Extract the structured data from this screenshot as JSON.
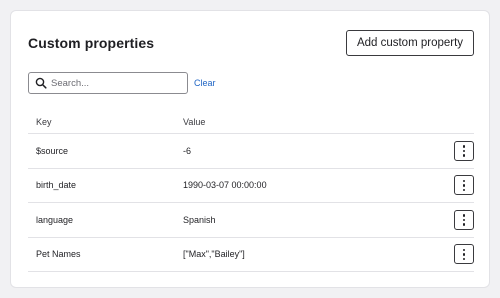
{
  "header": {
    "title": "Custom properties",
    "add_button_label": "Add custom property"
  },
  "search": {
    "placeholder": "Search...",
    "value": "",
    "clear_label": "Clear"
  },
  "table": {
    "columns": {
      "key": "Key",
      "value": "Value"
    },
    "rows": [
      {
        "key": "$source",
        "value": "-6"
      },
      {
        "key": "birth_date",
        "value": "1990-03-07 00:00:00"
      },
      {
        "key": "language",
        "value": "Spanish"
      },
      {
        "key": "Pet Names",
        "value": "[\"Max\",\"Bailey\"]"
      }
    ]
  },
  "icons": {
    "search": "search-icon",
    "row_menu": "more-vertical-icon"
  },
  "colors": {
    "link": "#2166c5",
    "border": "#e2e2e6",
    "text": "#1f1f23"
  }
}
